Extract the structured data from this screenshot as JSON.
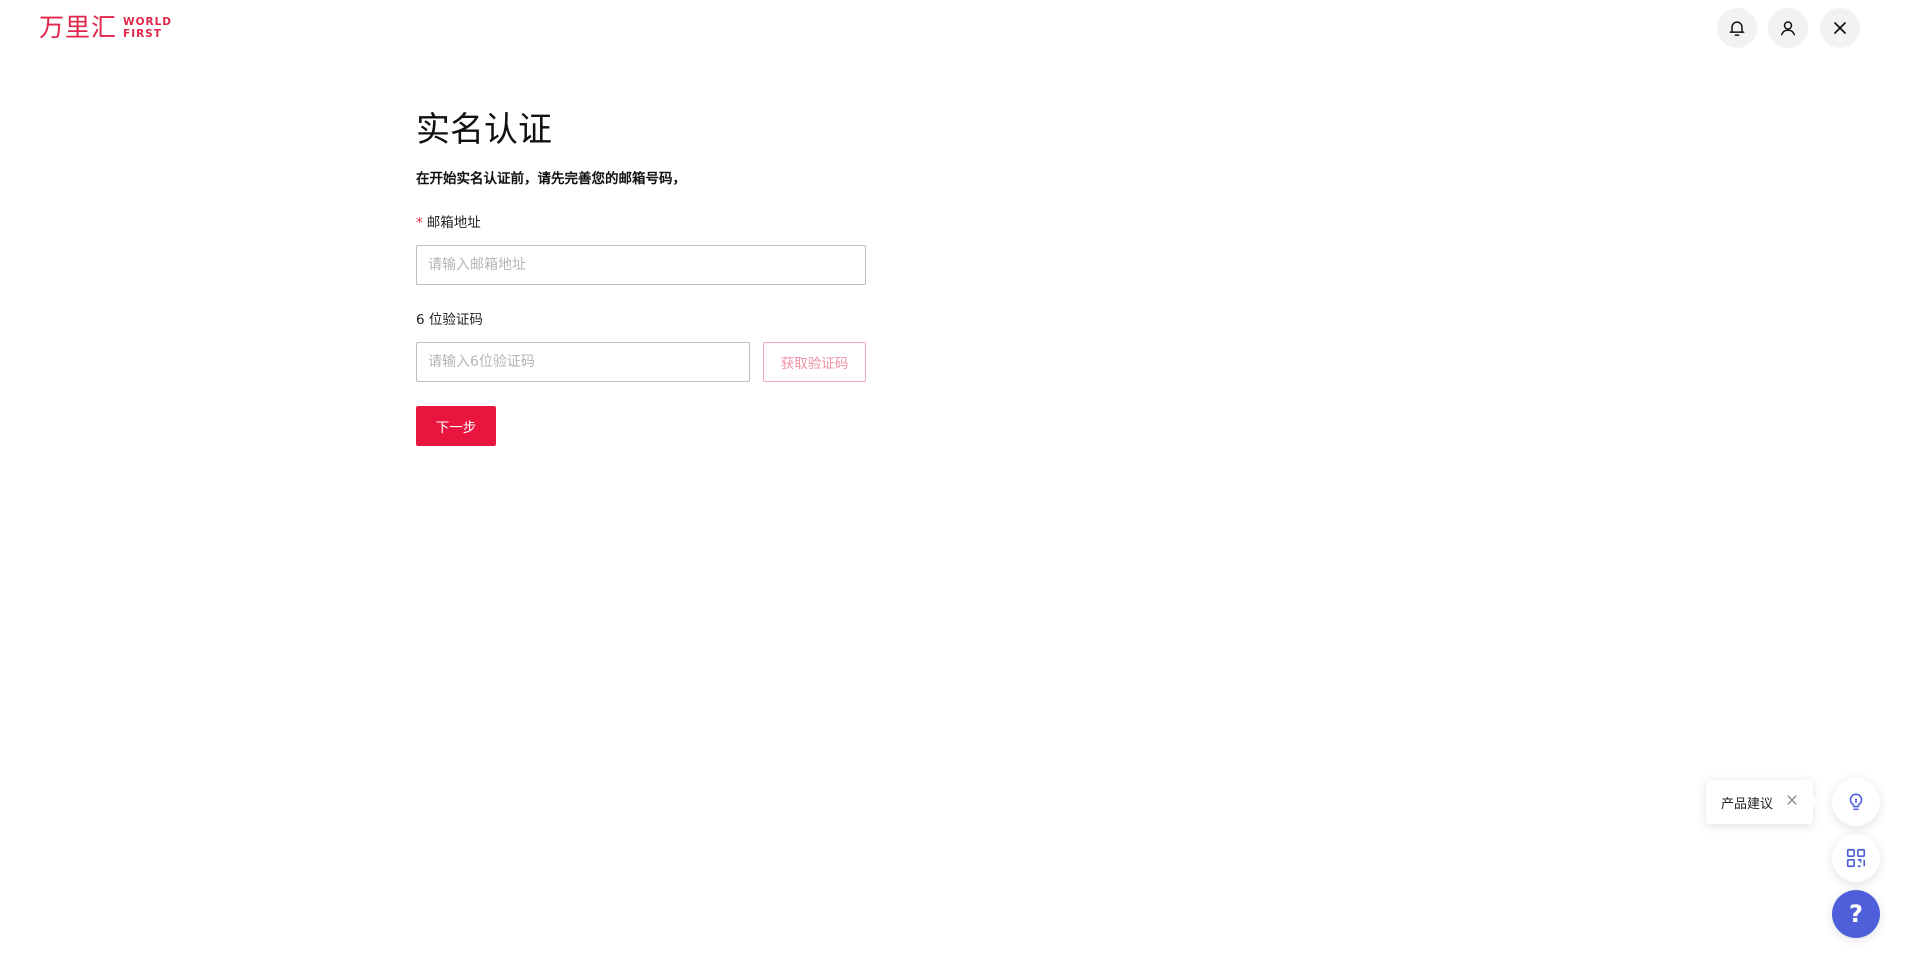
{
  "header": {
    "logo_cn": "万里汇",
    "logo_en_line1": "WORLD",
    "logo_en_line2": "FIRST",
    "icons": {
      "notification": "bell-icon",
      "account": "user-icon",
      "close": "close-icon"
    }
  },
  "form": {
    "title": "实名认证",
    "subtitle": "在开始实名认证前，请先完善您的邮箱号码，",
    "email": {
      "required_mark": "*",
      "label": "邮箱地址",
      "placeholder": "请输入邮箱地址",
      "value": ""
    },
    "code": {
      "label": "6 位验证码",
      "placeholder": "请输入6位验证码",
      "value": "",
      "get_code_label": "获取验证码"
    },
    "next_label": "下一步"
  },
  "floating": {
    "suggestion_label": "产品建议",
    "icons": {
      "suggestion": "lightbulb-icon",
      "qr": "qr-code-icon",
      "help": "question-icon"
    },
    "help_glyph": "?"
  },
  "colors": {
    "brand": "#e0274a",
    "primary_button": "#e8163f",
    "help_button": "#4f5fd9"
  }
}
